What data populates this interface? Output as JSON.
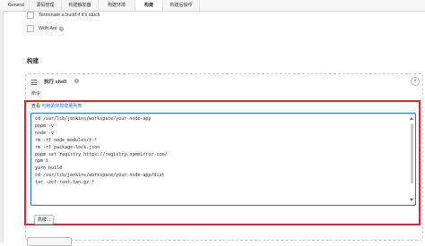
{
  "tabs": [
    {
      "label": "General"
    },
    {
      "label": "源码管理"
    },
    {
      "label": "构建触发器"
    },
    {
      "label": "构建环境"
    },
    {
      "label": "构建"
    },
    {
      "label": "构建后操作"
    }
  ],
  "active_tab": "构建",
  "options": {
    "terminate_label": "Terminate a build if it's stuck",
    "with_ant_label": "With Ant",
    "terminate_checked": false,
    "with_ant_checked": false
  },
  "section": {
    "title": "构建"
  },
  "build_step": {
    "title": "执行 shell",
    "close_symbol": "×",
    "command_label": "命令",
    "env_prefix": "查看",
    "env_link": "可用的环境变量列表",
    "script_lines": [
      "cd /var/lib/jenkins/workspace/your-node-app",
      "pnpm -v",
      "node -v",
      "",
      "rm -rf node_modules/f-*",
      "rm -rf package-lock.json",
      "pnpm set registry https://registry.npmmirror.com/",
      "npm i",
      "yarn build",
      "cd /var/lib/jenkins/workspace/your-node-app/dist",
      "tar -zcf root.tan.gz *"
    ],
    "preview_label": "高级..."
  },
  "help_symbol": "?",
  "colors": {
    "highlight": "#d9272e",
    "link": "#1e6fd9",
    "textarea_border": "#2f6fc4"
  }
}
